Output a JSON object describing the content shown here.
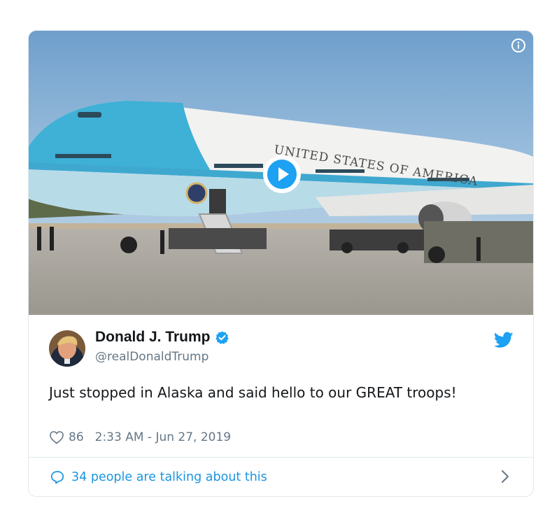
{
  "media": {
    "plane_text": "UNITED STATES OF AMERICA"
  },
  "tweet": {
    "name": "Donald J. Trump",
    "handle": "@realDonaldTrump",
    "text": "Just stopped in Alaska and said hello to our GREAT troops!",
    "likes": "86",
    "timestamp": "2:33 AM - Jun 27, 2019"
  },
  "footer": {
    "talking": "34 people are talking about this"
  },
  "colors": {
    "twitter_blue": "#1da1f2",
    "link_blue": "#1b95e0",
    "secondary_text": "#657786",
    "border": "#e1e8ed"
  },
  "icons": [
    "info-icon",
    "play-icon",
    "verified-icon",
    "twitter-bird-icon",
    "heart-icon",
    "speech-bubble-icon",
    "chevron-right-icon"
  ]
}
